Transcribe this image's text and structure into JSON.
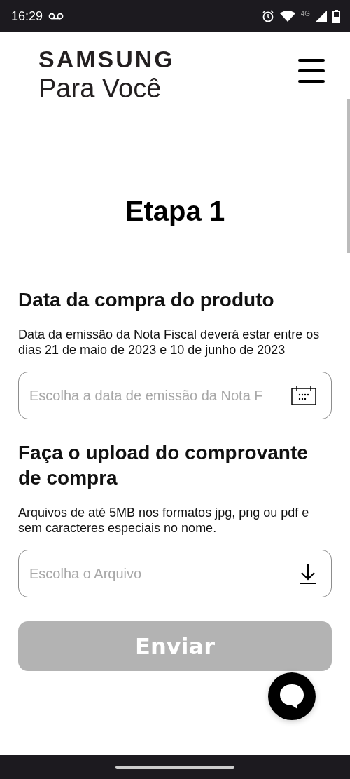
{
  "status_bar": {
    "time": "16:29",
    "network": "4G"
  },
  "header": {
    "brand": "SAMSUNG",
    "subtitle": "Para Você"
  },
  "page_title": "Etapa 1",
  "sections": [
    {
      "heading": "Data da compra do produto",
      "description": "Data da emissão da Nota Fiscal deverá estar entre os dias 21 de maio de 2023 e 10 de junho de 2023",
      "field": {
        "kind": "date",
        "placeholder": "Escolha a data de emissão da Nota F"
      }
    },
    {
      "heading": "Faça o upload do comprovante de compra",
      "description": "Arquivos de até 5MB nos formatos jpg, png ou pdf e sem caracteres especiais no nome.",
      "field": {
        "kind": "file",
        "placeholder": "Escolha o Arquivo"
      }
    }
  ],
  "submit_button": {
    "label": "Enviar",
    "disabled": true
  }
}
